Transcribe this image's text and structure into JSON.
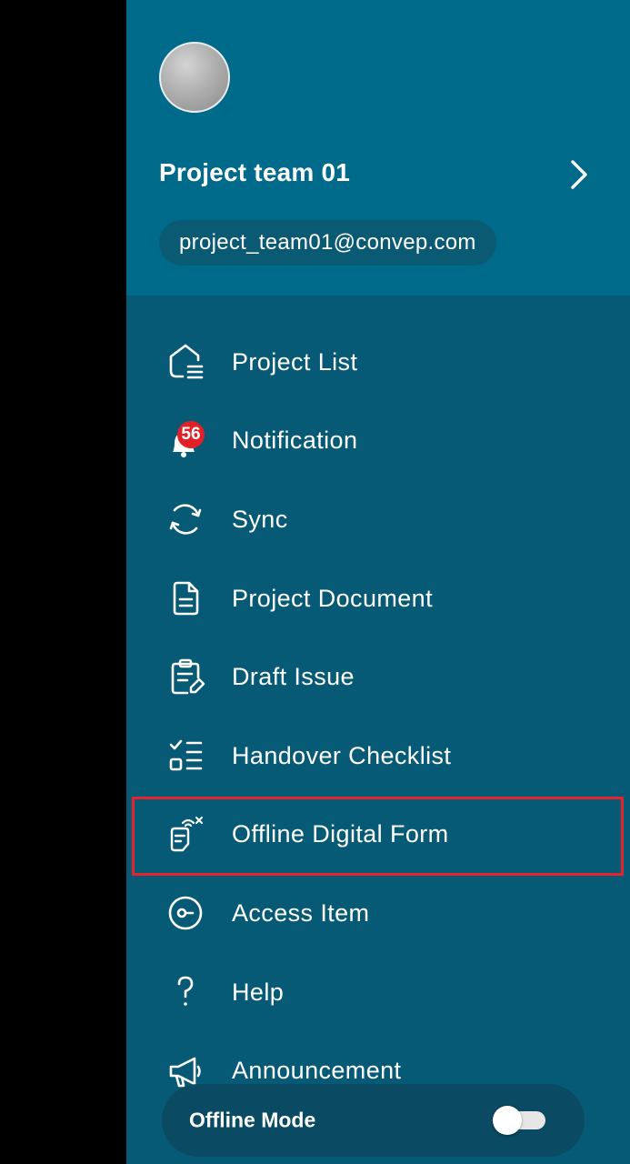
{
  "profile": {
    "name": "Project team 01",
    "email": "project_team01@convep.com"
  },
  "menu": {
    "items": [
      {
        "label": "Project List",
        "icon": "project-list-icon"
      },
      {
        "label": "Notification",
        "icon": "notification-icon",
        "badge": "56"
      },
      {
        "label": "Sync",
        "icon": "sync-icon"
      },
      {
        "label": "Project Document",
        "icon": "document-icon"
      },
      {
        "label": "Draft Issue",
        "icon": "draft-issue-icon"
      },
      {
        "label": "Handover Checklist",
        "icon": "checklist-icon"
      },
      {
        "label": "Offline Digital Form",
        "icon": "offline-form-icon"
      },
      {
        "label": "Access Item",
        "icon": "access-item-icon"
      },
      {
        "label": "Help",
        "icon": "help-icon"
      },
      {
        "label": "Announcement",
        "icon": "megaphone-icon"
      }
    ]
  },
  "offline_mode": {
    "label": "Offline Mode",
    "enabled": false
  },
  "colors": {
    "header_bg": "#006a8a",
    "drawer_bg": "#075a75",
    "badge": "#e32026",
    "highlight": "#e4232a"
  }
}
